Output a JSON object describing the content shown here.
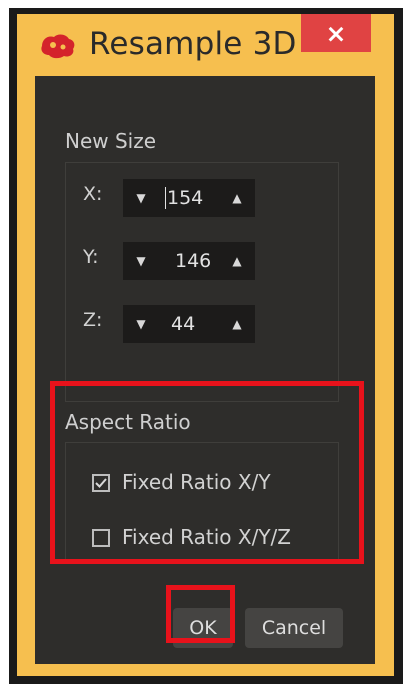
{
  "window": {
    "title": "Resample 3D",
    "close_glyph": "×",
    "icon": "red-app-icon"
  },
  "new_size": {
    "label": "New Size",
    "rows": [
      {
        "axis": "X:",
        "value": "154"
      },
      {
        "axis": "Y:",
        "value": "146"
      },
      {
        "axis": "Z:",
        "value": "44"
      }
    ],
    "spin_down_glyph": "▼",
    "spin_up_glyph": "▲"
  },
  "aspect_ratio": {
    "label": "Aspect Ratio",
    "options": [
      {
        "label": "Fixed Ratio X/Y",
        "checked": true
      },
      {
        "label": "Fixed Ratio X/Y/Z",
        "checked": false
      }
    ]
  },
  "buttons": {
    "ok": "OK",
    "cancel": "Cancel"
  },
  "colors": {
    "frame": "#f6bf4f",
    "client": "#2e2d2b",
    "close": "#e04343",
    "highlight": "#e8121b"
  }
}
